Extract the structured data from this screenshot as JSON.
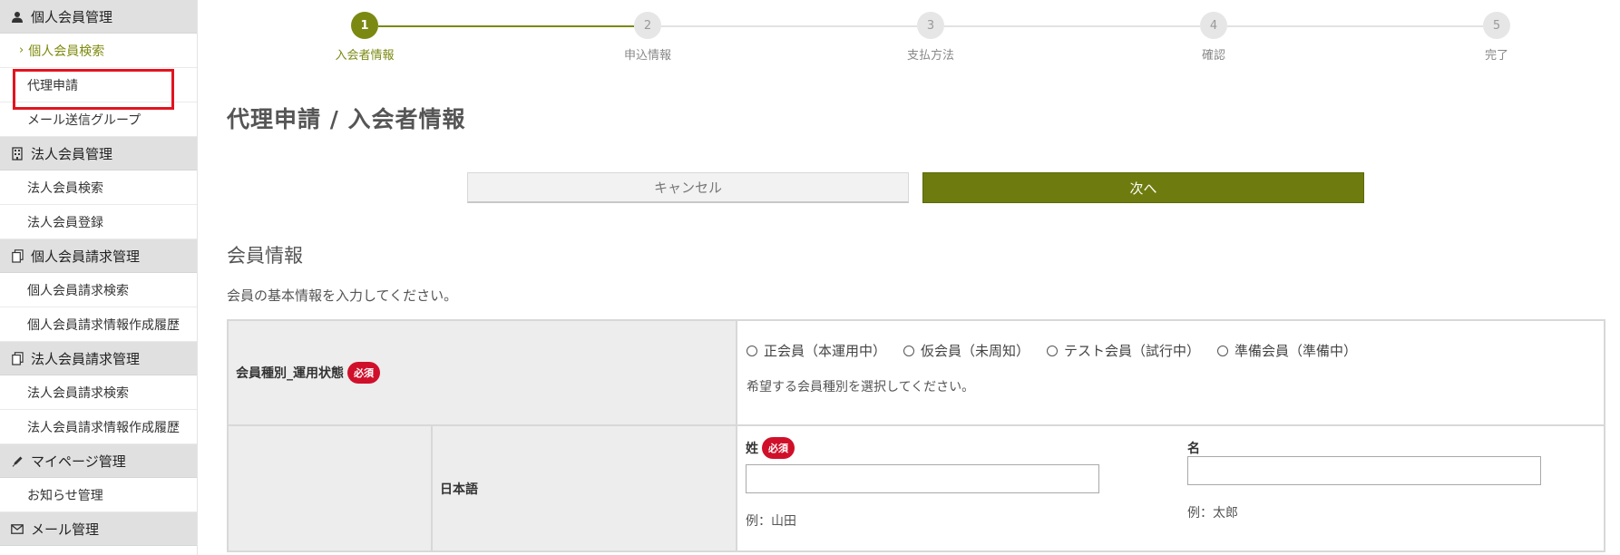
{
  "sidebar": {
    "sections": [
      {
        "title": "個人会員管理",
        "icon": "user-icon",
        "items": [
          {
            "label": "個人会員検索",
            "active": true,
            "highlighted": false
          },
          {
            "label": "代理申請",
            "active": false,
            "highlighted": true
          },
          {
            "label": "メール送信グループ",
            "active": false,
            "highlighted": false
          }
        ]
      },
      {
        "title": "法人会員管理",
        "icon": "building-icon",
        "items": [
          {
            "label": "法人会員検索",
            "active": false,
            "highlighted": false
          },
          {
            "label": "法人会員登録",
            "active": false,
            "highlighted": false
          }
        ]
      },
      {
        "title": "個人会員請求管理",
        "icon": "document-icon",
        "items": [
          {
            "label": "個人会員請求検索",
            "active": false,
            "highlighted": false
          },
          {
            "label": "個人会員請求情報作成履歴",
            "active": false,
            "highlighted": false
          }
        ]
      },
      {
        "title": "法人会員請求管理",
        "icon": "document-icon",
        "items": [
          {
            "label": "法人会員請求検索",
            "active": false,
            "highlighted": false
          },
          {
            "label": "法人会員請求情報作成履歴",
            "active": false,
            "highlighted": false
          }
        ]
      },
      {
        "title": "マイページ管理",
        "icon": "pencil-icon",
        "items": [
          {
            "label": "お知らせ管理",
            "active": false,
            "highlighted": false
          }
        ]
      },
      {
        "title": "メール管理",
        "icon": "envelope-icon",
        "items": []
      }
    ]
  },
  "stepper": {
    "current": 1,
    "steps": [
      {
        "num": "1",
        "label": "入会者情報"
      },
      {
        "num": "2",
        "label": "申込情報"
      },
      {
        "num": "3",
        "label": "支払方法"
      },
      {
        "num": "4",
        "label": "確認"
      },
      {
        "num": "5",
        "label": "完了"
      }
    ]
  },
  "page": {
    "title": "代理申請 / 入会者情報"
  },
  "buttons": {
    "cancel": "キャンセル",
    "next": "次へ"
  },
  "section": {
    "title": "会員情報",
    "description": "会員の基本情報を入力してください。"
  },
  "form": {
    "required_badge": "必須",
    "member_type": {
      "label": "会員種別_運用状態",
      "options": [
        "正会員（本運用中）",
        "仮会員（未周知）",
        "テスト会員（試行中）",
        "準備会員（準備中）"
      ],
      "help": "希望する会員種別を選択してください。"
    },
    "name": {
      "sub_label": "日本語",
      "last_label": "姓",
      "first_label": "名",
      "last_value": "",
      "first_value": "",
      "last_example": "例：山田",
      "first_example": "例：太郎"
    }
  },
  "colors": {
    "accent": "#7b8912",
    "next_button": "#6e7c0f",
    "required": "#d0102a",
    "highlight_box": "#e3141e"
  }
}
